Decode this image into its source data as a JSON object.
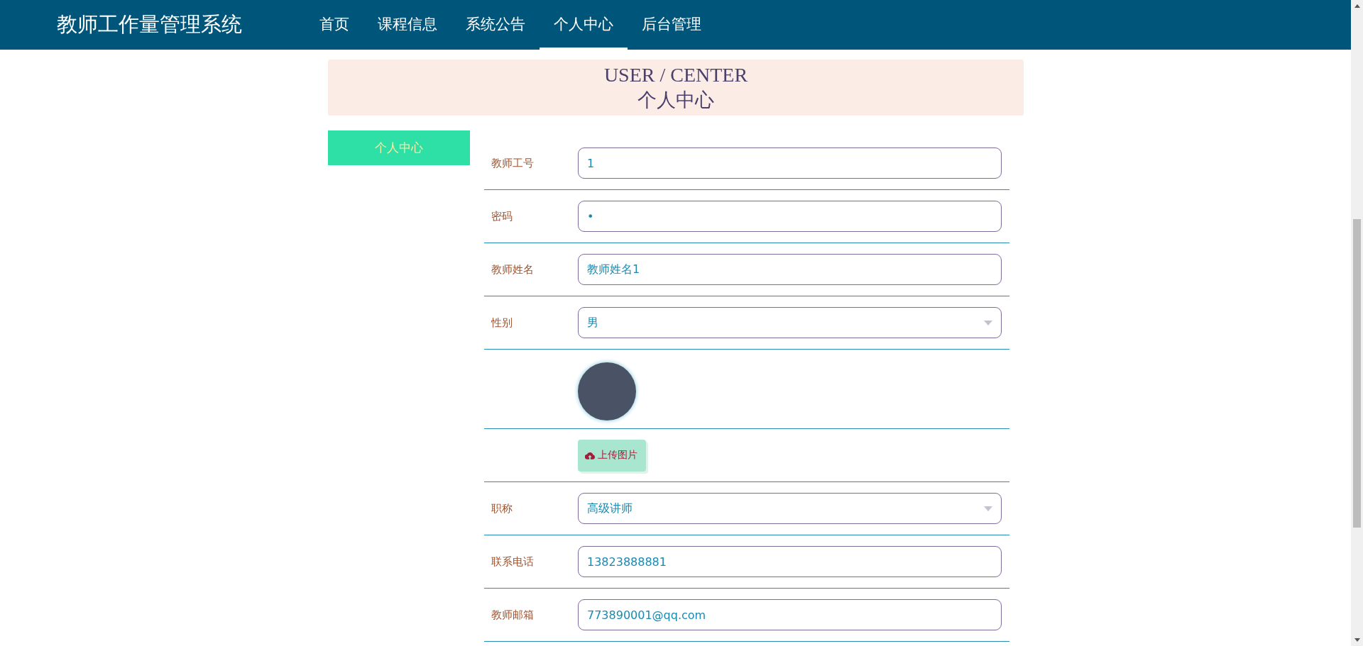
{
  "header": {
    "title": "教师工作量管理系统",
    "nav": [
      {
        "label": "首页",
        "selected": false
      },
      {
        "label": "课程信息",
        "selected": false
      },
      {
        "label": "系统公告",
        "selected": false
      },
      {
        "label": "个人中心",
        "selected": true
      },
      {
        "label": "后台管理",
        "selected": false
      }
    ]
  },
  "banner": {
    "title_en": "USER / CENTER",
    "title": "个人中心"
  },
  "sidebar": {
    "items": [
      {
        "label": "个人中心",
        "selected": true
      }
    ]
  },
  "form": {
    "rows": [
      {
        "kind": "text",
        "label": "教师工号",
        "value": "1"
      },
      {
        "kind": "text",
        "label": "密码",
        "value": "•"
      },
      {
        "kind": "text",
        "label": "教师姓名",
        "value": "教师姓名1"
      },
      {
        "kind": "select",
        "label": "性别",
        "value": "男"
      },
      {
        "kind": "image"
      },
      {
        "kind": "upload",
        "button": "上传图片"
      },
      {
        "kind": "select",
        "label": "职称",
        "value": "高级讲师"
      },
      {
        "kind": "text",
        "label": "联系电话",
        "value": "13823888881"
      },
      {
        "kind": "text",
        "label": "教师邮箱",
        "value": "773890001@qq.com"
      }
    ]
  }
}
